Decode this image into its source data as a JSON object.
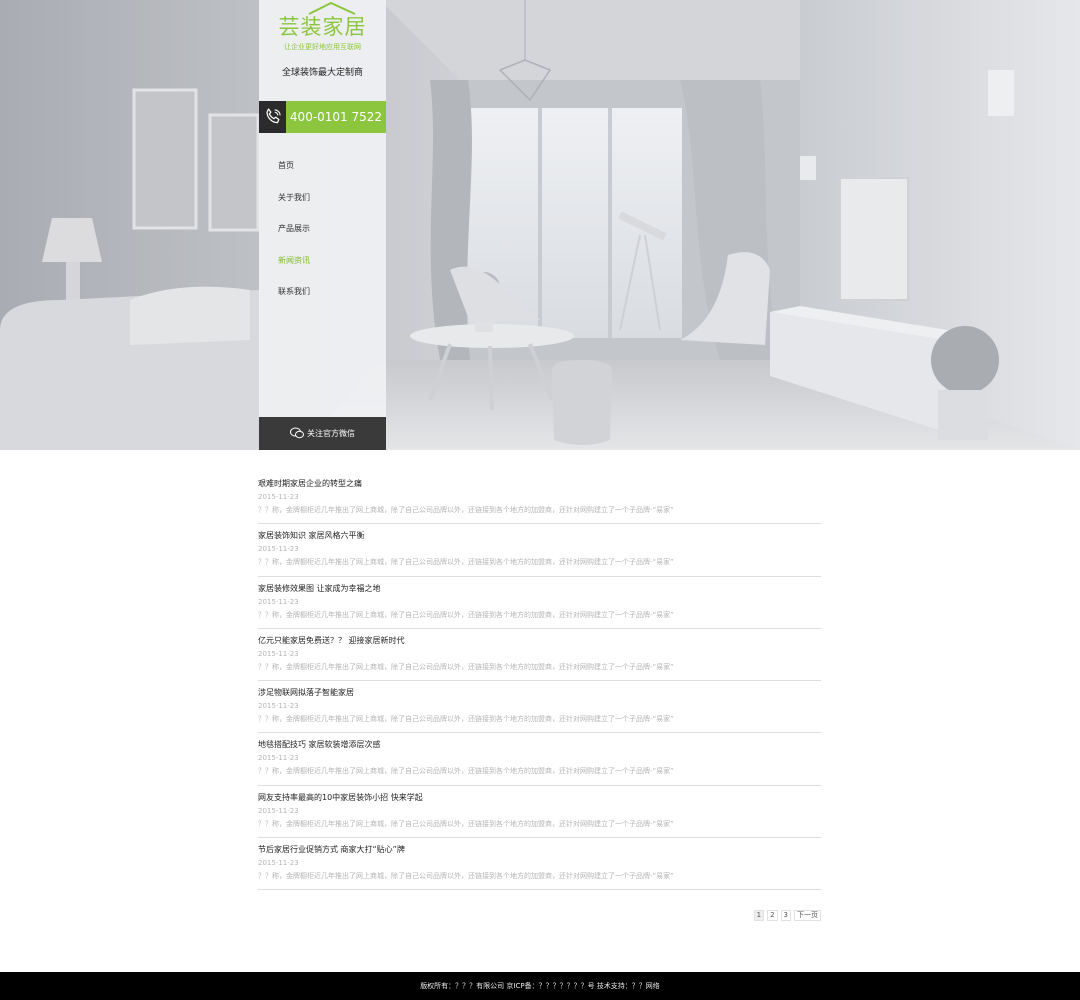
{
  "sidebar": {
    "logo_text": "芸装家居",
    "logo_slogan": "让企业更好地应用互联网",
    "tagline": "全球装饰最大定制商",
    "phone": "400-0101 7522",
    "nav": [
      {
        "label": "首页",
        "active": false
      },
      {
        "label": "关于我们",
        "active": false
      },
      {
        "label": "产品展示",
        "active": false
      },
      {
        "label": "新闻资讯",
        "active": true
      },
      {
        "label": "联系我们",
        "active": false
      }
    ],
    "wechat_label": "关注官方微信"
  },
  "news": [
    {
      "title": "艰难时期家居企业的转型之痛",
      "date": "2015-11-23",
      "excerpt": "？？称，金牌橱柜近几年推出了网上商城，除了自己公司品牌以外，还链接到各个地方的加盟商，还针对网购建立了一个子品牌-“易家”"
    },
    {
      "title": "家居装饰知识 家居风格六平衡",
      "date": "2015-11-23",
      "excerpt": "？？称，金牌橱柜近几年推出了网上商城，除了自己公司品牌以外，还链接到各个地方的加盟商，还针对网购建立了一个子品牌-“易家”"
    },
    {
      "title": "家居装修效果图 让家成为幸福之地",
      "date": "2015-11-23",
      "excerpt": "？？称，金牌橱柜近几年推出了网上商城，除了自己公司品牌以外，还链接到各个地方的加盟商，还针对网购建立了一个子品牌-“易家”"
    },
    {
      "title": "亿元只能家居免费送？？ 迎接家居新时代",
      "date": "2015-11-23",
      "excerpt": "？？称，金牌橱柜近几年推出了网上商城，除了自己公司品牌以外，还链接到各个地方的加盟商，还针对网购建立了一个子品牌-“易家”"
    },
    {
      "title": "涉足物联网拟落子智能家居",
      "date": "2015-11-23",
      "excerpt": "？？称，金牌橱柜近几年推出了网上商城，除了自己公司品牌以外，还链接到各个地方的加盟商，还针对网购建立了一个子品牌-“易家”"
    },
    {
      "title": "地毯搭配技巧 家居软装增添层次感",
      "date": "2015-11-23",
      "excerpt": "？？称，金牌橱柜近几年推出了网上商城，除了自己公司品牌以外，还链接到各个地方的加盟商，还针对网购建立了一个子品牌-“易家”"
    },
    {
      "title": "网友支持率最高的10中家居装饰小招 快来学起",
      "date": "2015-11-23",
      "excerpt": "？？称，金牌橱柜近几年推出了网上商城，除了自己公司品牌以外，还链接到各个地方的加盟商，还针对网购建立了一个子品牌-“易家”"
    },
    {
      "title": "节后家居行业促销方式 商家大打“贴心”牌",
      "date": "2015-11-23",
      "excerpt": "？？称，金牌橱柜近几年推出了网上商城，除了自己公司品牌以外，还链接到各个地方的加盟商，还针对网购建立了一个子品牌-“易家”"
    }
  ],
  "pagination": {
    "pages": [
      "1",
      "2",
      "3"
    ],
    "current": "1",
    "next_label": "下一页"
  },
  "footer": {
    "text": "版权所有：？？？有限公司  京ICP备：？？？？？？？号  技术支持：？？网络"
  },
  "colors": {
    "accent": "#8cc63f",
    "dark": "#2b2b2b",
    "footer_bg": "#000000"
  },
  "icons": {
    "phone": "phone-icon",
    "wechat": "wechat-icon"
  }
}
